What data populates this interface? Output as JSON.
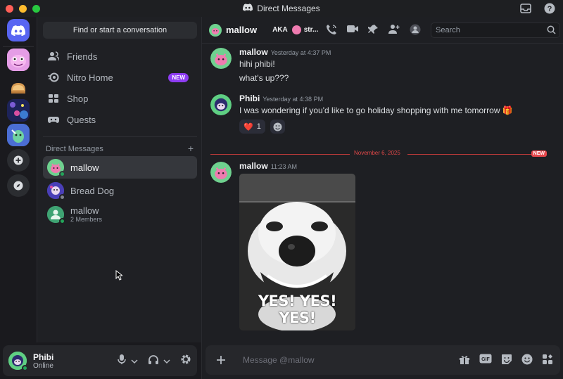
{
  "window": {
    "title": "Direct Messages",
    "traffic_colors": [
      "#ff5f57",
      "#febc2e",
      "#28c840"
    ]
  },
  "sidebar": {
    "find_label": "Find or start a conversation",
    "nav": [
      {
        "label": "Friends",
        "icon": "friends-icon"
      },
      {
        "label": "Nitro Home",
        "icon": "nitro-icon",
        "badge": "NEW"
      },
      {
        "label": "Shop",
        "icon": "shop-icon"
      },
      {
        "label": "Quests",
        "icon": "quests-icon"
      }
    ],
    "dm_header": "Direct Messages",
    "dm_add": "+",
    "dms": [
      {
        "name": "mallow",
        "sub": "",
        "status": "online",
        "active": true
      },
      {
        "name": "Bread Dog",
        "sub": "",
        "status": "offline",
        "active": false
      },
      {
        "name": "mallow",
        "sub": "2 Members",
        "status": "online",
        "active": false
      }
    ]
  },
  "user_panel": {
    "name": "Phibi",
    "status": "Online"
  },
  "topbar": {
    "name": "mallow",
    "aka_label": "AKA",
    "aka_value": "str...",
    "search_placeholder": "Search"
  },
  "messages": [
    {
      "author": "mallow",
      "time": "Yesterday at 4:37 PM",
      "lines": [
        "hihi phibi!",
        "what's up???"
      ]
    },
    {
      "author": "Phibi",
      "time": "Yesterday at 4:38 PM",
      "lines": [
        "I was wondering if you'd like to go holiday shopping with me tomorrow 🎁"
      ],
      "reaction": {
        "emoji": "❤️",
        "count": "1"
      }
    },
    {
      "author": "mallow",
      "time": "11:23 AM",
      "gif_caption": "YES! YES! YES!"
    }
  ],
  "divider": {
    "date": "November 6, 2025",
    "new_label": "NEW"
  },
  "composer": {
    "placeholder": "Message @mallow"
  },
  "colors": {
    "accent": "#5865f2",
    "online": "#23a55a",
    "new_badge": "#8e3cf2",
    "unread": "#e5484d"
  }
}
